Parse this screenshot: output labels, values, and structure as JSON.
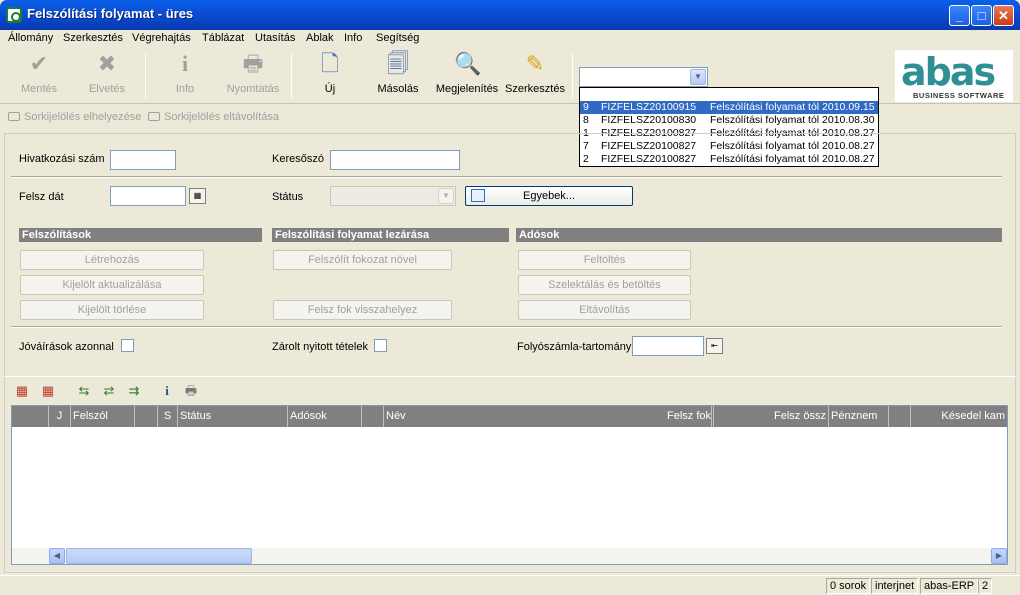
{
  "window": {
    "title": "Felszólítási folyamat - üres",
    "min": "_",
    "max": "□",
    "close": "✕"
  },
  "menu": [
    "Állomány",
    "Szerkesztés",
    "Végrehajtás",
    "Táblázat",
    "Utasítás",
    "Ablak",
    "Info",
    "Segítség"
  ],
  "toolbar": {
    "save": "Mentés",
    "discard": "Elvetés",
    "info": "Info",
    "print": "Nyomtatás",
    "new": "Új",
    "copy": "Másolás",
    "show": "Megjelenítés",
    "edit": "Szerkesztés"
  },
  "combo": {
    "value": ""
  },
  "dropdown": [
    {
      "n": "9",
      "code": "FIZFELSZ20100915",
      "desc": "Felszólítási folyamat tól 2010.09.15",
      "selected": true
    },
    {
      "n": "8",
      "code": "FIZFELSZ20100830",
      "desc": "Felszólítási folyamat tól 2010.08.30",
      "selected": false
    },
    {
      "n": "1",
      "code": "FIZFELSZ20100827",
      "desc": "Felszólítási folyamat tól 2010.08.27",
      "selected": false
    },
    {
      "n": "7",
      "code": "FIZFELSZ20100827",
      "desc": "Felszólítási folyamat tól 2010.08.27",
      "selected": false
    },
    {
      "n": "2",
      "code": "FIZFELSZ20100827",
      "desc": "Felszólítási folyamat tól 2010.08.27",
      "selected": false
    }
  ],
  "logo": {
    "text": "abas",
    "sub": "BUSINESS SOFTWARE"
  },
  "subtoolbar": {
    "place_mark": "Sorkijelölés elhelyezése",
    "remove_mark": "Sorkijelölés eltávolítása"
  },
  "form": {
    "ref_label": "Hivatkozási szám",
    "keyword_label": "Keresőszó",
    "date_label": "Felsz dát",
    "status_label": "Státus",
    "others_button": "Egyebek...",
    "credits_label": "Jóváírások azonnal",
    "locked_label": "Zárolt nyitott tételek",
    "account_label": "Folyószámla-tartomány"
  },
  "sections": {
    "reminders": "Felszólítások",
    "closing": "Felszólítási folyamat lezárása",
    "debtors": "Adósok"
  },
  "buttons": {
    "create": "Létrehozás",
    "update_selected": "Kijelölt aktualizálása",
    "delete_selected": "Kijelölt törlése",
    "raise_level": "Felszólít fokozat növel",
    "reset_level": "Felsz fok visszahelyez",
    "fill": "Feltöltés",
    "select_load": "Szelektálás és betöltés",
    "remove": "Eltávolítás"
  },
  "grid": {
    "columns": [
      "",
      "J",
      "Felszól",
      "",
      "S",
      "Státus",
      "Adósok",
      "",
      "Név",
      "Felsz fok",
      "Felsz össz",
      "Pénznem",
      "",
      "Késedel kam"
    ]
  },
  "status": {
    "rows": "0 sorok",
    "mode": "interjnet",
    "app": "abas-ERP",
    "num": "2"
  }
}
